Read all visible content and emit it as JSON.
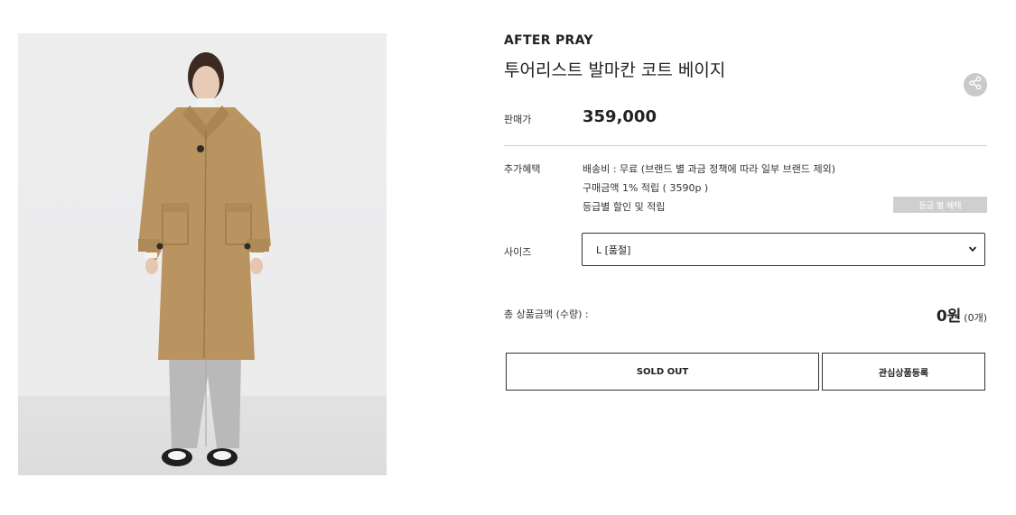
{
  "product": {
    "brand": "AFTER PRAY",
    "title": "투어리스트 발마칸 코트 베이지",
    "price_label": "판매가",
    "price": "359,000",
    "photo_icon": "product-photo-beige-coat"
  },
  "benefits": {
    "label": "추가혜택",
    "lines": [
      "배송비 : 무료 (브랜드 별 과금 정책에 따라 일부 브랜드 제외)",
      "구매금액 1% 적립 ( 3590p )",
      "등급별 할인 및 적립"
    ],
    "grade_button_label": "등급 별 혜택"
  },
  "size": {
    "label": "사이즈",
    "selected": "L [품절]"
  },
  "total": {
    "label": "총 상품금액 (수량) :",
    "amount": "0원",
    "qty": "(0개)"
  },
  "actions": {
    "soldout_label": "SOLD OUT",
    "wishlist_label": "관심상품등록"
  },
  "icons": {
    "share": "share-icon",
    "dropdown": "chevron-down-icon"
  },
  "colors": {
    "coat": "#b99460",
    "share_bg": "#c9c9c9",
    "grade_btn_bg": "#cfcfcf"
  }
}
